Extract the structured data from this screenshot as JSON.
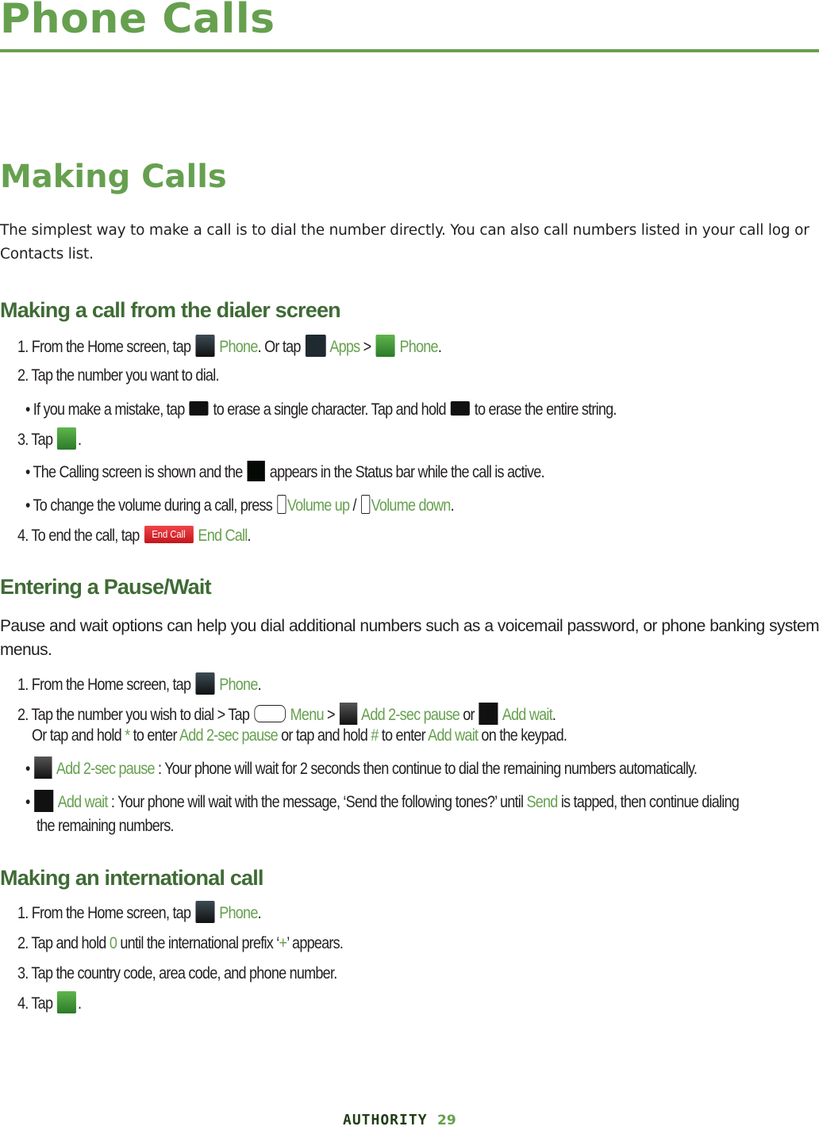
{
  "page": {
    "chapter_title": "Phone Calls",
    "section_title": "Making Calls",
    "intro": "The simplest way to make a call is to dial the number directly. You can also call numbers listed in your call log or Contacts list.",
    "colors": {
      "accent_green": "#66a04f",
      "subhead_green": "#3f6b35",
      "text": "#231f20",
      "end_call_red": "#d9252b"
    }
  },
  "dialer": {
    "heading": "Making a call from the dialer screen",
    "step1": {
      "prefix": "1. From the Home screen, tap",
      "icon1": "phone-icon",
      "link1": "Phone",
      "mid": ". Or tap",
      "icon2": "apps-grid-icon",
      "link2": "Apps",
      "sep": " > ",
      "icon3": "phone-green-icon",
      "link3": "Phone",
      "end": "."
    },
    "step2": "2. Tap the number you want to dial.",
    "bullet_mistake": {
      "prefix": "• If you make a mistake, tap",
      "icon": "backspace-icon",
      "mid": "to erase a single character. Tap and hold",
      "end": "to erase the entire string."
    },
    "step3": {
      "prefix": "3. Tap",
      "icon": "call-button-icon",
      "end": "."
    },
    "bullet_calling": {
      "prefix": "• The Calling screen is shown and the",
      "icon": "status-phone-icon",
      "end": "appears in the Status bar while the call is active."
    },
    "bullet_volume": {
      "prefix": "• To change the volume during a call, press",
      "icon_up": "volume-up-key-icon",
      "link_up": "Volume up",
      "sep": " / ",
      "icon_down": "volume-down-key-icon",
      "link_down": "Volume down",
      "end": "."
    },
    "step4": {
      "prefix": "4. To end the call, tap",
      "button_label": "End Call",
      "link": "End Call",
      "end": "."
    }
  },
  "pause": {
    "heading": "Entering a Pause/Wait",
    "intro": "Pause and wait options can help you dial additional numbers such as a voicemail password, or phone banking system menus.",
    "step1": {
      "prefix": "1. From the Home screen, tap",
      "link": "Phone",
      "end": "."
    },
    "step2": {
      "prefix": "2. Tap the number you wish to dial > Tap",
      "link_menu": "Menu",
      "sep": " > ",
      "link_pause": "Add 2-sec pause",
      "or": " or ",
      "link_wait": "Add wait",
      "end": "."
    },
    "step2b": {
      "a": "Or tap and hold",
      "star": "*",
      "b": "to enter",
      "pause": "Add 2-sec pause",
      "c": "or tap and hold",
      "hash": "#",
      "d": "to enter",
      "wait": "Add wait",
      "e": "on the keypad."
    },
    "bullet_pause": {
      "dot": "•",
      "link": "Add 2-sec pause",
      "text": ": Your phone will wait for 2 seconds then continue to dial the remaining numbers automatically."
    },
    "bullet_wait": {
      "dot": "•",
      "link": "Add wait",
      "text": ": Your phone will wait with the message, ‘Send the following tones?’ until",
      "send": "Send",
      "text2": "is tapped, then continue dialing",
      "line2": "the remaining numbers."
    }
  },
  "intl": {
    "heading": "Making an international call",
    "step1": {
      "prefix": "1. From the Home screen, tap",
      "link": "Phone",
      "end": "."
    },
    "step2": {
      "prefix": "2. Tap and hold",
      "zero": "0",
      "mid": "until the international prefix ‘",
      "plus": "+",
      "end": "’ appears."
    },
    "step3": "3. Tap the country code, area code, and phone number.",
    "step4": {
      "prefix": "4. Tap",
      "end": "."
    }
  },
  "footer": {
    "brand": "AUTHORITY",
    "page_number": "29"
  }
}
